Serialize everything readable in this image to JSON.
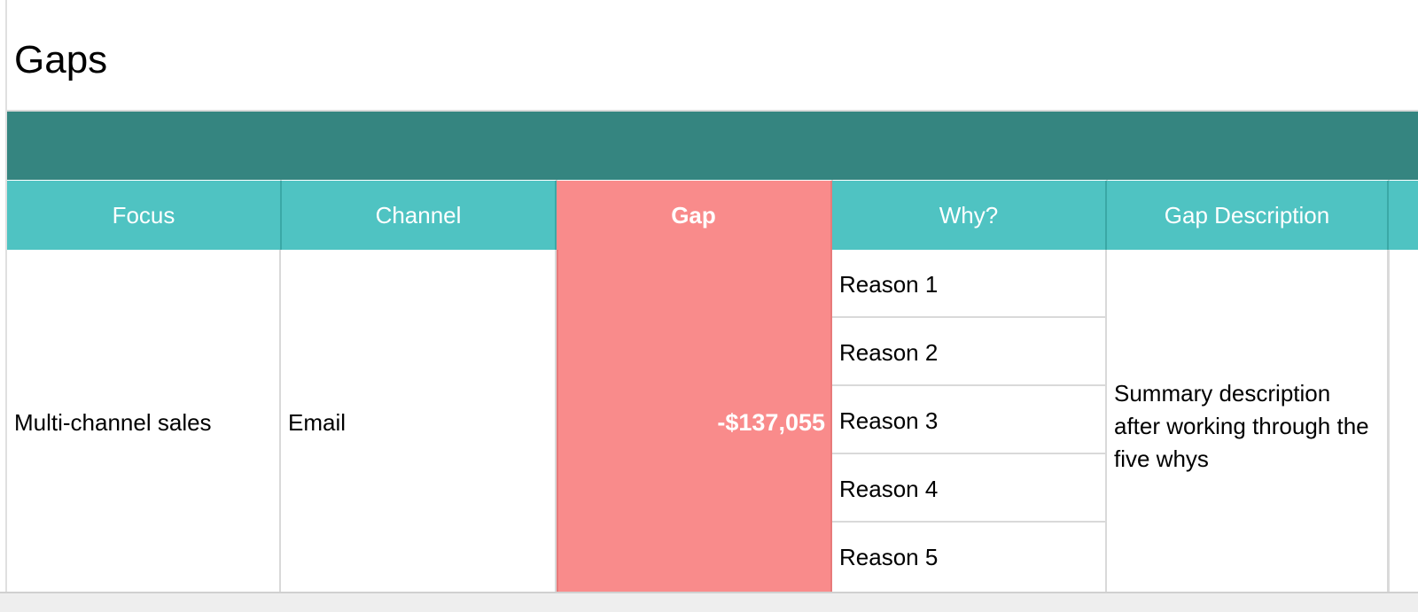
{
  "sheet": {
    "title": "Gaps",
    "colors": {
      "banner": "#358580",
      "header": "#4fc3c2",
      "gap_highlight": "#f98b8b"
    },
    "table": {
      "headers": [
        "Focus",
        "Channel",
        "Gap",
        "Why?",
        "Gap Description"
      ],
      "row": {
        "focus": "Multi-channel sales",
        "channel": "Email",
        "gap": "-$137,055",
        "reasons": [
          "Reason 1",
          "Reason 2",
          "Reason 3",
          "Reason 4",
          "Reason 5"
        ],
        "description": "Summary description after working through the five whys"
      }
    }
  }
}
